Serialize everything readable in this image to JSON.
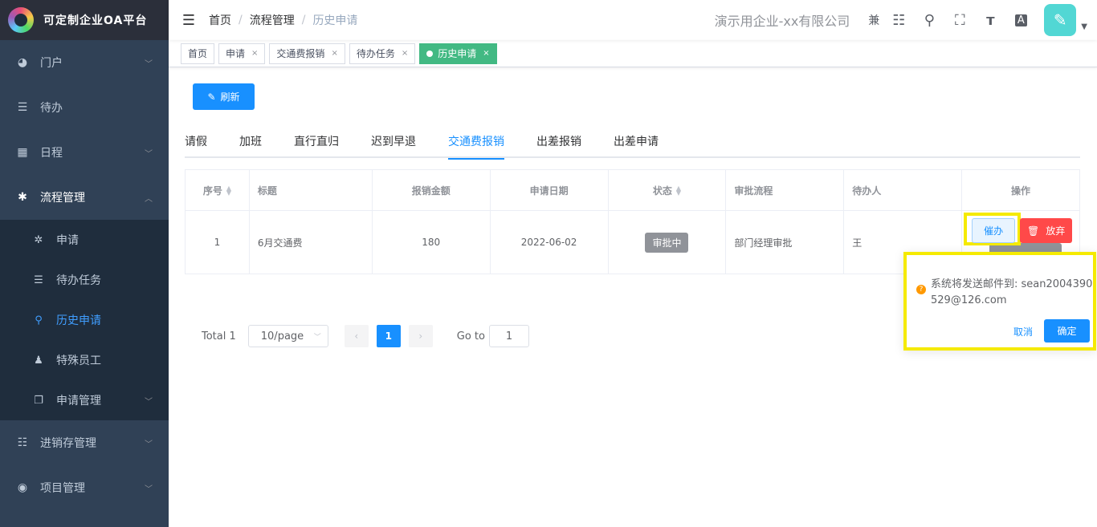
{
  "app": {
    "title": "可定制企业OA平台"
  },
  "sidebar": {
    "items": [
      {
        "label": "门户",
        "icon": "dashboard-icon",
        "glyph": "◕",
        "arrow": "﹀"
      },
      {
        "label": "待办",
        "icon": "list-icon",
        "glyph": "☰",
        "arrow": ""
      },
      {
        "label": "日程",
        "icon": "grid-icon",
        "glyph": "▦",
        "arrow": "﹀"
      },
      {
        "label": "流程管理",
        "icon": "workflow-icon",
        "glyph": "✱",
        "arrow": "︿"
      }
    ],
    "subitems": [
      {
        "label": "申请",
        "icon": "apply-icon",
        "glyph": "✲"
      },
      {
        "label": "待办任务",
        "icon": "task-list-icon",
        "glyph": "☰"
      },
      {
        "label": "历史申请",
        "icon": "search-icon",
        "glyph": "⚲"
      },
      {
        "label": "特殊员工",
        "icon": "user-icon",
        "glyph": "♟"
      },
      {
        "label": "申请管理",
        "icon": "copy-icon",
        "glyph": "❐",
        "arrow": "﹀"
      }
    ],
    "bottom_items": [
      {
        "label": "进销存管理",
        "icon": "tree-table-icon",
        "glyph": "☷",
        "arrow": "﹀"
      },
      {
        "label": "项目管理",
        "icon": "eye-icon",
        "glyph": "◉",
        "arrow": "﹀"
      }
    ]
  },
  "navbar": {
    "breadcrumb": [
      "首页",
      "流程管理",
      "历史申请"
    ],
    "separator": "/",
    "company": "演示用企业-xx有限公司",
    "extra": "兼",
    "icons": [
      "menu-tree-icon",
      "search-icon",
      "fullscreen-icon",
      "font-size-icon",
      "translate-icon"
    ]
  },
  "tags": [
    {
      "label": "首页"
    },
    {
      "label": "申请"
    },
    {
      "label": "交通费报销"
    },
    {
      "label": "待办任务"
    },
    {
      "label": "历史申请",
      "active": true
    }
  ],
  "toolbar": {
    "refresh_label": "刷新"
  },
  "tabs": [
    "请假",
    "加班",
    "直行直归",
    "迟到早退",
    "交通费报销",
    "出差报销",
    "出差申请"
  ],
  "active_tab": "交通费报销",
  "table": {
    "headers": [
      "序号",
      "标题",
      "报销金额",
      "申请日期",
      "状态",
      "审批流程",
      "待办人",
      "操作"
    ],
    "rows": [
      {
        "index": "1",
        "title": "6月交通费",
        "amount": "180",
        "date": "2022-06-02",
        "status": "审批中",
        "flow": "部门经理审批",
        "assignee": "王"
      }
    ],
    "actions": {
      "urge": "催办",
      "abandon": "放弃"
    }
  },
  "pagination": {
    "total": "Total 1",
    "page_size": "10/page",
    "current": "1",
    "goto_label": "Go to",
    "goto_value": "1"
  },
  "popconfirm": {
    "message": "系统将发送邮件到: sean2004390529@126.com",
    "cancel": "取消",
    "confirm": "确定"
  },
  "colors": {
    "primary": "#1890ff",
    "sidebar": "#304156",
    "active_tag": "#42b983",
    "danger": "#ff4949",
    "highlight": "#f5ea00"
  }
}
